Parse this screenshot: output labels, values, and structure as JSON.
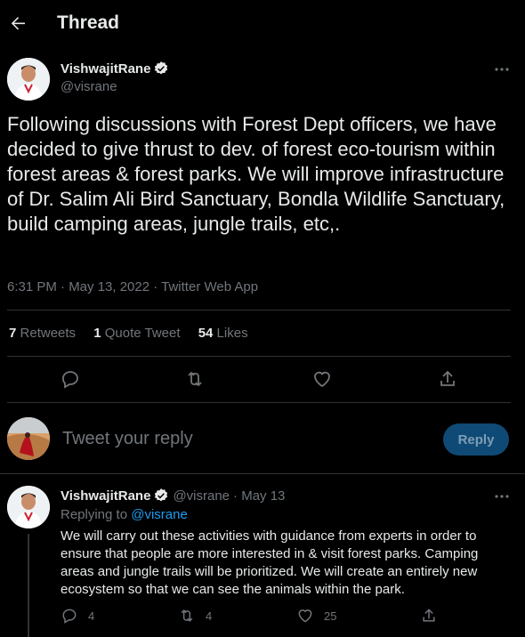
{
  "header": {
    "title": "Thread",
    "back_icon": "arrow-left-icon"
  },
  "tweet": {
    "display_name": "VishwajitRane",
    "handle": "@visrane",
    "text": "Following discussions with Forest Dept officers, we have decided to give thrust to dev. of forest eco-tourism within forest areas & forest parks. We will improve infrastructure of Dr. Salim Ali Bird Sanctuary, Bondla Wildlife Sanctuary, build camping areas, jungle trails, etc,.",
    "timestamp": "6:31 PM · May 13, 2022 · Twitter Web App",
    "stats": {
      "retweets_count": "7",
      "retweets_label": "Retweets",
      "quotes_count": "1",
      "quotes_label": "Quote Tweet",
      "likes_count": "54",
      "likes_label": "Likes"
    }
  },
  "reply_box": {
    "placeholder": "Tweet your reply",
    "button_label": "Reply"
  },
  "reply_tweet": {
    "display_name": "VishwajitRane",
    "handle": "@visrane",
    "date": "· May 13",
    "replying_prefix": "Replying to",
    "replying_handle": "@visrane",
    "text": "We will carry out these activities with guidance from experts in order to ensure that people are more interested in & visit forest parks. Camping areas and jungle trails will be prioritized. We will create an entirely new ecosystem so that we can see the animals within the park.",
    "actions": {
      "replies": "4",
      "retweets": "4",
      "likes": "25"
    }
  },
  "colors": {
    "accent": "#1d9bf0",
    "verified": "#e7e9ea",
    "background": "#000000"
  }
}
